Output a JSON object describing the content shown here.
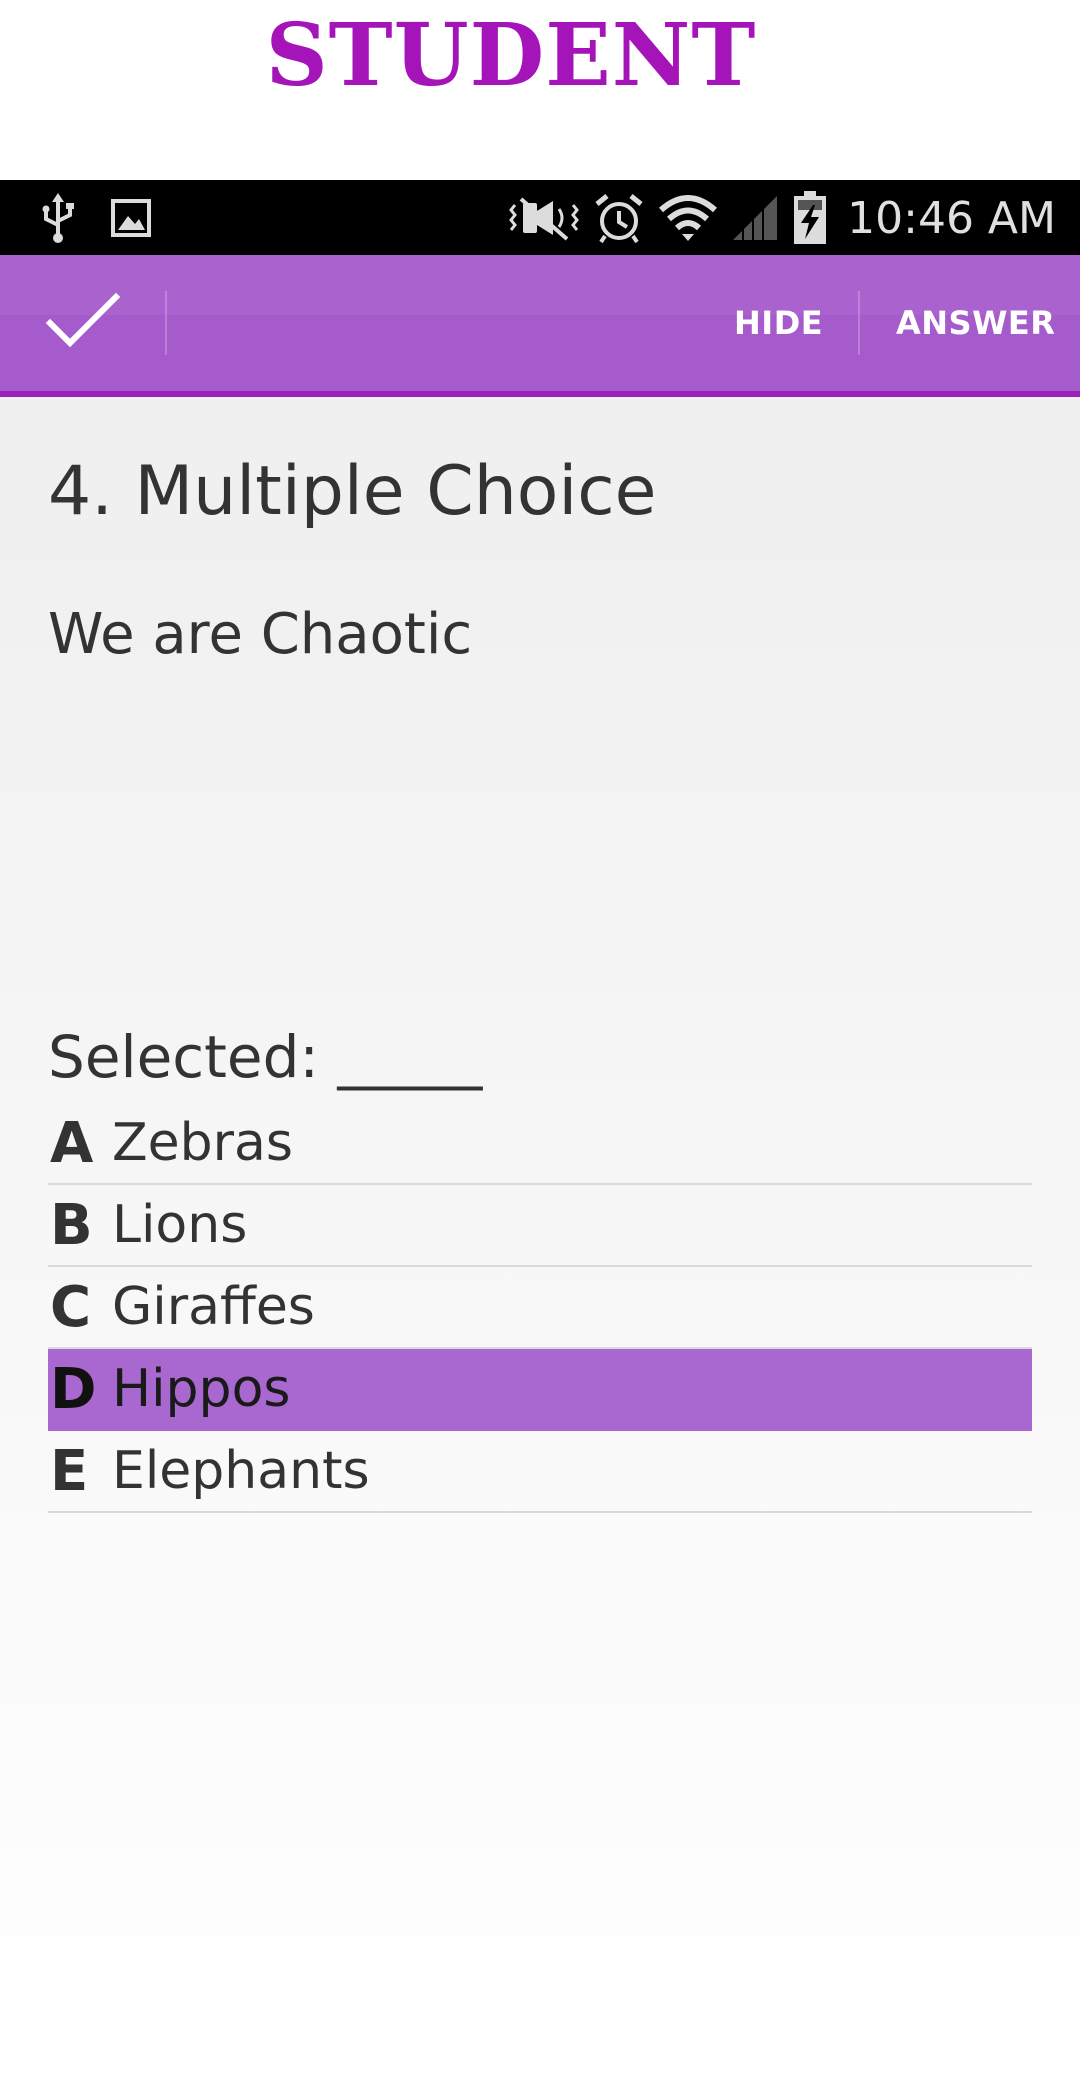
{
  "banner": {
    "title": "STUDENT"
  },
  "status_bar": {
    "time": "10:46 AM",
    "left_icons": [
      "usb-icon",
      "image-icon"
    ],
    "right_icons": [
      "vibrate-icon",
      "alarm-icon",
      "wifi-icon",
      "signal-icon",
      "battery-charging-icon"
    ]
  },
  "action_bar": {
    "done_icon": "checkmark-icon",
    "hide_label": "HIDE",
    "answer_label": "ANSWER",
    "color": "#a65bcc"
  },
  "question": {
    "title": "4. Multiple Choice",
    "text": "We are Chaotic",
    "selected_label": "Selected: _____",
    "options": [
      {
        "letter": "A",
        "text": "Zebras",
        "selected": false
      },
      {
        "letter": "B",
        "text": "Lions",
        "selected": false
      },
      {
        "letter": "C",
        "text": "Giraffes",
        "selected": false
      },
      {
        "letter": "D",
        "text": "Hippos",
        "selected": true
      },
      {
        "letter": "E",
        "text": "Elephants",
        "selected": false
      }
    ],
    "highlight_color": "#a968d0"
  }
}
